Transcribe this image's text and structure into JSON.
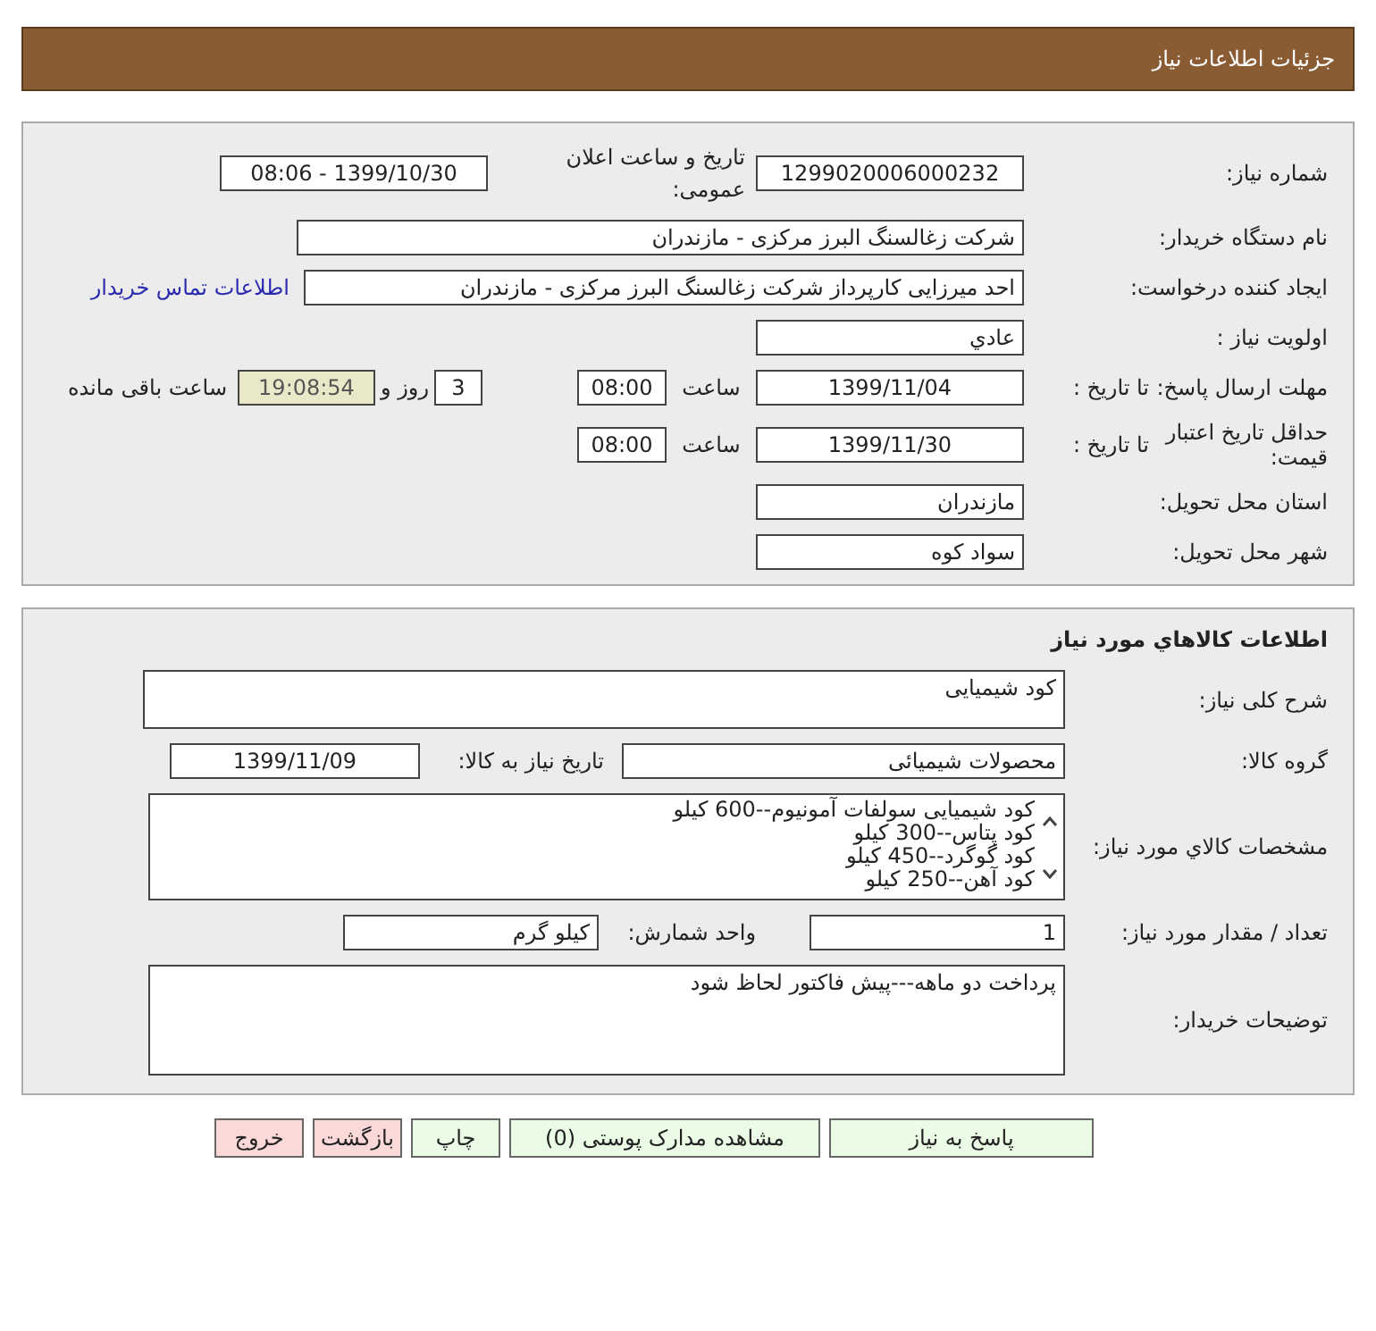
{
  "header": {
    "title": "جزئیات اطلاعات نیاز"
  },
  "need": {
    "need_number": {
      "label": "شماره نیاز:",
      "value": "1299020006000232"
    },
    "announce": {
      "label": "تاریخ و ساعت اعلان عمومی:",
      "value": "1399/10/30 - 08:06"
    },
    "buyer": {
      "label": "نام دستگاه خریدار:",
      "value": "شرکت زغالسنگ البرز مرکزی - مازندران"
    },
    "creator": {
      "label": "ایجاد کننده درخواست:",
      "value": "احد میرزایی کارپرداز شرکت زغالسنگ البرز مرکزی - مازندران",
      "link": "اطلاعات تماس خریدار"
    },
    "priority": {
      "label": "اولویت نیاز :",
      "value": "عادي"
    },
    "deadline": {
      "label": "مهلت ارسال پاسخ:",
      "to_label": "تا تاریخ :",
      "date": "1399/11/04",
      "time_label": "ساعت",
      "time": "08:00",
      "days": "3",
      "days_label": "روز و",
      "remaining": "19:08:54",
      "remaining_label": "ساعت باقی مانده"
    },
    "validity": {
      "label": "حداقل تاریخ اعتبار قیمت:",
      "to_label": "تا تاریخ :",
      "date": "1399/11/30",
      "time_label": "ساعت",
      "time": "08:00"
    },
    "province": {
      "label": "استان محل تحویل:",
      "value": "مازندران"
    },
    "city": {
      "label": "شهر محل تحویل:",
      "value": "سواد کوه"
    }
  },
  "goods": {
    "title": "اطلاعات کالاهاي مورد نیاز",
    "description": {
      "label": "شرح کلی نیاز:",
      "value": "کود شیمیایی"
    },
    "group": {
      "label": "گروه کالا:",
      "value": "محصولات شیمیائی"
    },
    "need_date": {
      "label": "تاریخ نیاز به کالا:",
      "value": "1399/11/09"
    },
    "specs": {
      "label": "مشخصات کالاي مورد نیاز:",
      "lines": [
        "کود شیمیایی سولفات آمونیوم--600 کیلو",
        "کود پتاس--300 کیلو",
        "کود گوگرد--450 کیلو",
        "کود آهن--250 کیلو"
      ]
    },
    "quantity": {
      "label": "تعداد / مقدار مورد نیاز:",
      "value": "1"
    },
    "unit": {
      "label": "واحد شمارش:",
      "value": "کیلو گرم"
    },
    "buyer_notes": {
      "label": "توضیحات خریدار:",
      "value": "پرداخت دو ماهه---پیش فاکتور لحاظ شود"
    }
  },
  "buttons": [
    {
      "label": "پاسخ به نیاز",
      "kind": "green"
    },
    {
      "label": "مشاهده مدارک پوستی (0)",
      "kind": "green"
    },
    {
      "label": "چاپ",
      "kind": "green"
    },
    {
      "label": "بازگشت",
      "kind": "pink"
    },
    {
      "label": "خروج",
      "kind": "pink"
    }
  ]
}
